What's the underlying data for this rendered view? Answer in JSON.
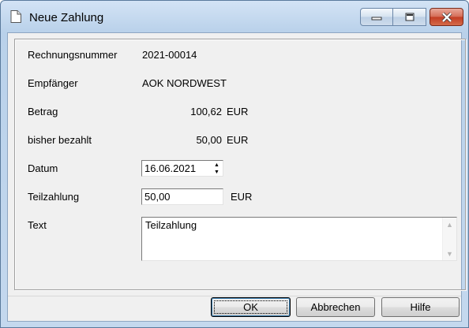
{
  "window": {
    "title": "Neue Zahlung",
    "icon": "document-icon",
    "controls": [
      "minimize-icon",
      "maximize-icon",
      "close-icon"
    ]
  },
  "form": {
    "rechnungsnummer": {
      "label": "Rechnungsnummer",
      "value": "2021-00014"
    },
    "empfaenger": {
      "label": "Empfänger",
      "value": "AOK NORDWEST"
    },
    "betrag": {
      "label": "Betrag",
      "value": "100,62",
      "unit": "EUR"
    },
    "bisher_bezahlt": {
      "label": "bisher bezahlt",
      "value": "50,00",
      "unit": "EUR"
    },
    "datum": {
      "label": "Datum",
      "value": "16.06.2021"
    },
    "teilzahlung": {
      "label": "Teilzahlung",
      "value": "50,00",
      "unit": "EUR"
    },
    "text": {
      "label": "Text",
      "value": "Teilzahlung"
    }
  },
  "buttons": {
    "ok": "OK",
    "cancel": "Abbrechen",
    "help": "Hilfe"
  }
}
